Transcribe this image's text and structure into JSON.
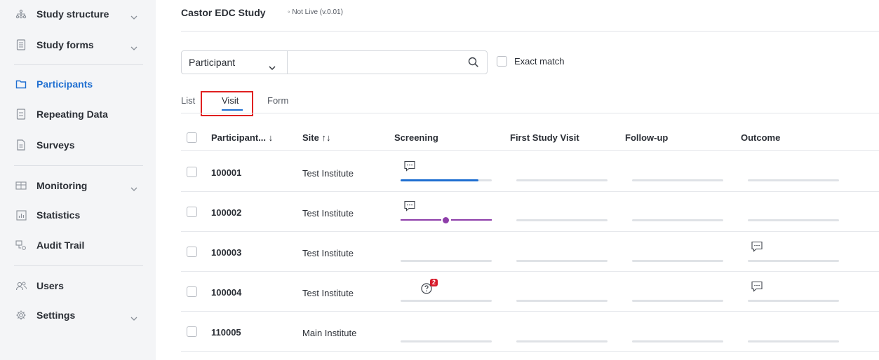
{
  "sidebar": {
    "items": [
      {
        "label": "Study structure",
        "icon": "hierarchy-icon",
        "chevron": true
      },
      {
        "label": "Study forms",
        "icon": "form-icon",
        "chevron": true
      },
      {
        "label": "Participants",
        "icon": "folder-icon",
        "chevron": false,
        "active": true
      },
      {
        "label": "Repeating Data",
        "icon": "list-icon",
        "chevron": false
      },
      {
        "label": "Surveys",
        "icon": "document-icon",
        "chevron": false
      },
      {
        "label": "Monitoring",
        "icon": "monitor-icon",
        "chevron": true
      },
      {
        "label": "Statistics",
        "icon": "bar-chart-icon",
        "chevron": false
      },
      {
        "label": "Audit Trail",
        "icon": "audit-icon",
        "chevron": false
      },
      {
        "label": "Users",
        "icon": "users-icon",
        "chevron": false
      },
      {
        "label": "Settings",
        "icon": "gear-icon",
        "chevron": true
      }
    ]
  },
  "header": {
    "title": "Castor EDC Study",
    "status": "◦ Not Live (v.0.01)"
  },
  "search": {
    "scope": "Participant",
    "value": "",
    "exact_match_label": "Exact match",
    "exact_match_checked": false
  },
  "tabs": [
    {
      "label": "List",
      "active": false
    },
    {
      "label": "Visit",
      "active": true
    },
    {
      "label": "Form",
      "active": false
    }
  ],
  "table": {
    "columns": [
      "Participant... ↓",
      "Site ↑↓",
      "Screening",
      "First Study Visit",
      "Follow-up",
      "Outcome"
    ],
    "rows": [
      {
        "id": "100001",
        "site": "Test Institute",
        "screening_progress": 0.85,
        "screening_comment": true,
        "screening_status": "progress",
        "outcome_comment": false
      },
      {
        "id": "100002",
        "site": "Test Institute",
        "screening_progress": 0,
        "screening_comment": true,
        "screening_status": "locked",
        "outcome_comment": false
      },
      {
        "id": "100003",
        "site": "Test Institute",
        "screening_progress": 0,
        "screening_comment": false,
        "screening_status": "none",
        "outcome_comment": true
      },
      {
        "id": "100004",
        "site": "Test Institute",
        "screening_progress": 0,
        "screening_comment": false,
        "screening_status": "query",
        "screening_query_count": "2",
        "outcome_comment": true
      },
      {
        "id": "110005",
        "site": "Main Institute",
        "screening_progress": 0,
        "screening_comment": false,
        "screening_status": "none",
        "outcome_comment": false
      }
    ]
  },
  "colors": {
    "accent": "#1f6fd1",
    "locked": "#8e3ea9",
    "badge": "#d71b2b",
    "highlight": "#e02020"
  }
}
